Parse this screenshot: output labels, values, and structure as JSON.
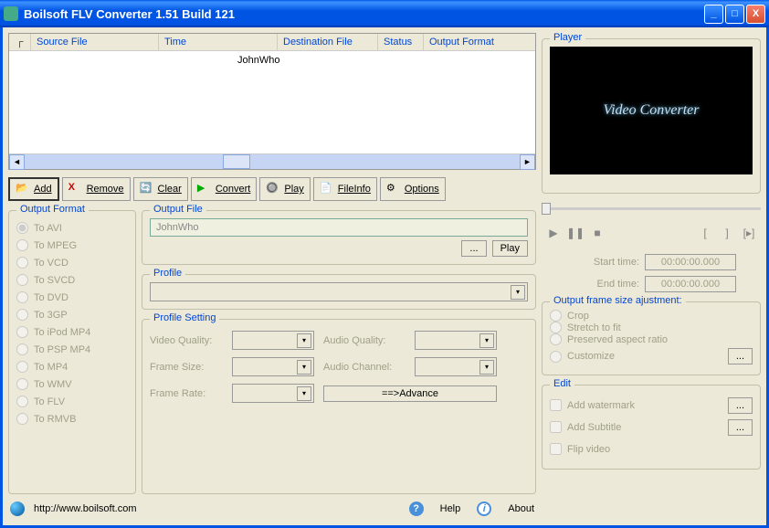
{
  "window": {
    "title": "Boilsoft FLV Converter 1.51 Build 121"
  },
  "table": {
    "headers": {
      "source": "Source File",
      "time": "Time",
      "dest": "Destination File",
      "status": "Status",
      "format": "Output Format"
    },
    "body_text": "JohnWho"
  },
  "toolbar": {
    "add": "Add",
    "remove": "Remove",
    "clear": "Clear",
    "convert": "Convert",
    "play": "Play",
    "fileinfo": "FileInfo",
    "options": "Options"
  },
  "output_format": {
    "title": "Output Format",
    "items": [
      "To AVI",
      "To MPEG",
      "To VCD",
      "To SVCD",
      "To DVD",
      "To 3GP",
      "To iPod MP4",
      "To PSP MP4",
      "To MP4",
      "To WMV",
      "To FLV",
      "To RMVB"
    ]
  },
  "output_file": {
    "title": "Output File",
    "value": "JohnWho",
    "browse": "...",
    "play": "Play"
  },
  "profile": {
    "title": "Profile"
  },
  "profile_setting": {
    "title": "Profile Setting",
    "video_quality": "Video Quality:",
    "frame_size": "Frame Size:",
    "frame_rate": "Frame Rate:",
    "audio_quality": "Audio Quality:",
    "audio_channel": "Audio Channel:",
    "advance": "==>Advance"
  },
  "player": {
    "title": "Player",
    "logo": "Video Converter",
    "start_label": "Start  time:",
    "end_label": "End   time:",
    "start_val": "00:00:00.000",
    "end_val": "00:00:00.000"
  },
  "frame_adjust": {
    "title": "Output frame size ajustment:",
    "crop": "Crop",
    "stretch": "Stretch to fit",
    "preserve": "Preserved aspect ratio",
    "customize": "Customize",
    "btn": "..."
  },
  "edit": {
    "title": "Edit",
    "watermark": "Add watermark",
    "subtitle": "Add Subtitle",
    "flip": "Flip video",
    "btn": "..."
  },
  "footer": {
    "url": "http://www.boilsoft.com",
    "help": "Help",
    "about": "About"
  }
}
